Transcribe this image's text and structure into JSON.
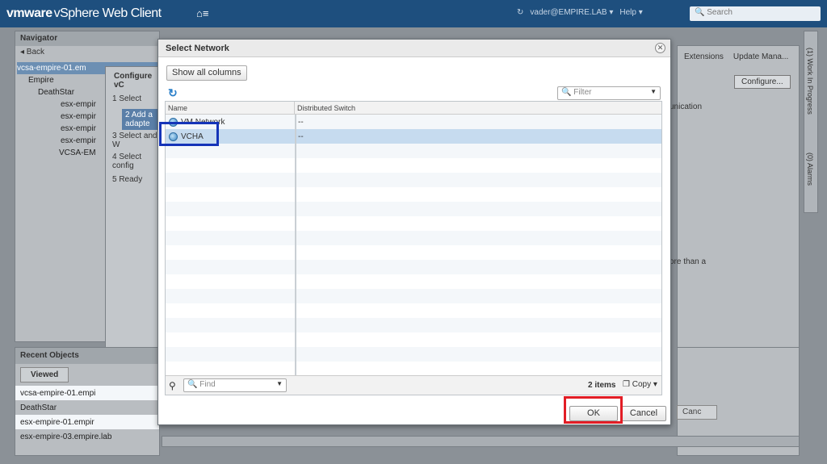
{
  "topbar": {
    "logo_vm": "vmware",
    "logo_rest": "vSphere Web Client",
    "home": "⌂≡",
    "refresh": "↻",
    "user": "vader@EMPIRE.LAB ▾",
    "help": "Help ▾",
    "search_placeholder": "Search"
  },
  "background": {
    "navigator_title": "Navigator",
    "back": "◂ Back",
    "tree": [
      "vcsa-empire-01.em",
      "Empire",
      "DeathStar",
      "esx-empir",
      "esx-empir",
      "esx-empir",
      "esx-empir",
      "VCSA-EM"
    ],
    "wizard_title": "Configure vC",
    "wizard_steps": [
      "1 Select",
      "2 Add a adapte",
      "3 Select and W",
      "4 Select config",
      "5 Ready"
    ],
    "recent_title": "Recent Objects",
    "recent_tab": "Viewed",
    "recent_items": [
      "vcsa-empire-01.empi",
      "DeathStar",
      "esx-empire-01.empir",
      "esx-empire-03.empire.lab"
    ],
    "right_tabs": [
      "Extensions",
      "Update Mana..."
    ],
    "configure_btn": "Configure...",
    "text1": "unication",
    "text2": "ore than a",
    "side1": "(1) Work In Progress",
    "side2": "(0) Alarms",
    "cancel_bg": "Canc"
  },
  "dialog": {
    "title": "Select Network",
    "close": "✕",
    "show_all": "Show all columns",
    "filter_placeholder": "Filter",
    "columns": [
      "Name",
      "Distributed Switch"
    ],
    "rows": [
      {
        "name": "VM Network",
        "switch": "--"
      },
      {
        "name": "VCHA",
        "switch": "--"
      }
    ],
    "find_placeholder": "Find",
    "items_count": "2 items",
    "copy": "Copy ▾",
    "ok": "OK",
    "cancel": "Cancel"
  }
}
